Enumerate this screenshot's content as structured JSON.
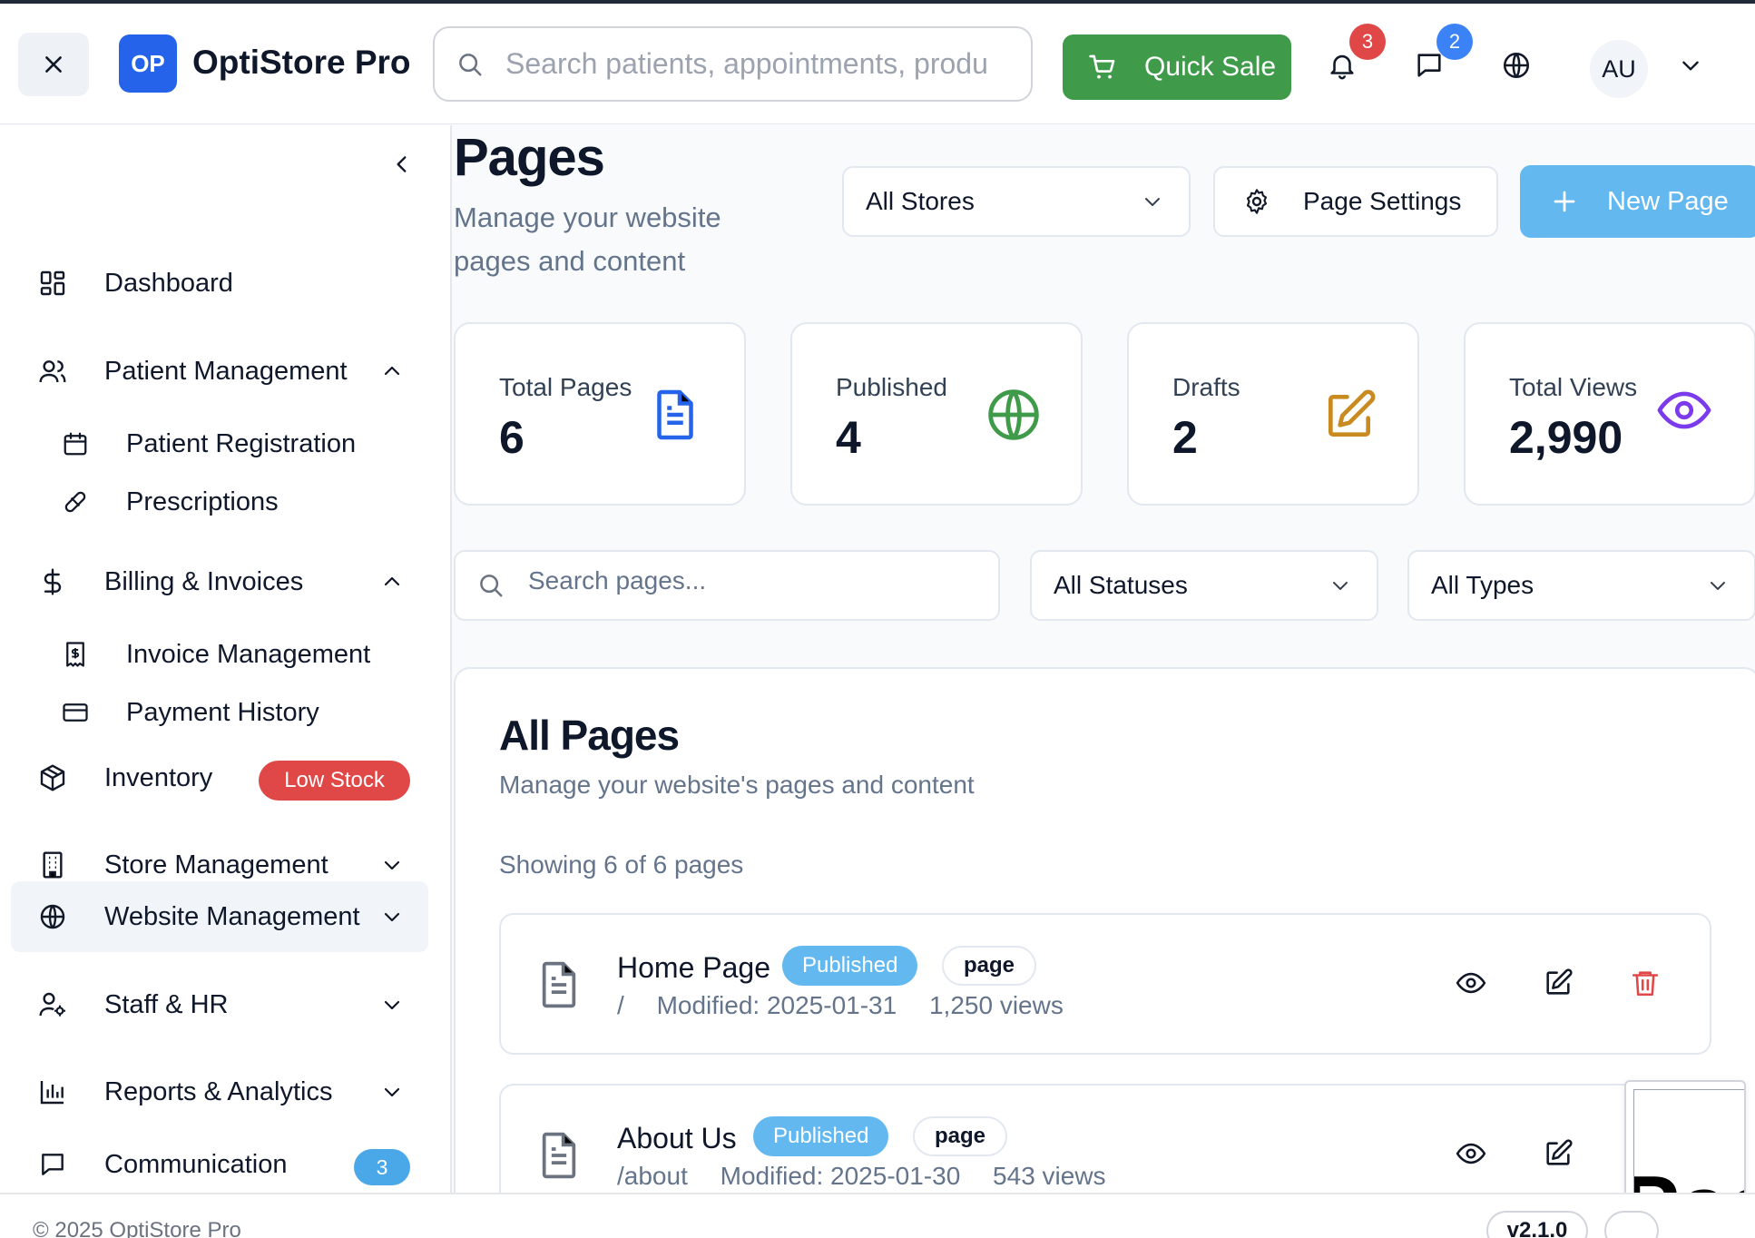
{
  "header": {
    "logo_initials": "OP",
    "brand": "OptiStore Pro",
    "search_placeholder": "Search patients, appointments, produ",
    "quick_sale_label": "Quick Sale",
    "notifications_count": "3",
    "messages_count": "2",
    "avatar_initials": "AU"
  },
  "sidebar": {
    "items": [
      {
        "label": "Dashboard",
        "icon": "dashboard-icon"
      },
      {
        "label": "Patient Management",
        "icon": "users-icon",
        "expanded": true
      },
      {
        "label": "Patient Registration",
        "icon": "calendar-icon"
      },
      {
        "label": "Prescriptions",
        "icon": "pill-icon"
      },
      {
        "label": "Billing & Invoices",
        "icon": "dollar-icon",
        "expanded": true
      },
      {
        "label": "Invoice Management",
        "icon": "receipt-icon"
      },
      {
        "label": "Payment History",
        "icon": "credit-card-icon"
      },
      {
        "label": "Inventory",
        "icon": "package-icon",
        "badge": "Low Stock"
      },
      {
        "label": "Store Management",
        "icon": "building-icon"
      },
      {
        "label": "Website Management",
        "icon": "globe-icon",
        "active": true
      },
      {
        "label": "Staff & HR",
        "icon": "user-cog-icon"
      },
      {
        "label": "Reports & Analytics",
        "icon": "bar-chart-icon"
      },
      {
        "label": "Communication",
        "icon": "message-icon",
        "badge": "3"
      }
    ]
  },
  "page": {
    "title": "Pages",
    "subtitle": "Manage your website pages and content",
    "store_select": "All Stores",
    "settings_label": "Page Settings",
    "new_page_label": "New Page"
  },
  "stats": [
    {
      "label": "Total Pages",
      "value": "6",
      "icon": "file-text-icon",
      "color": "#2563eb"
    },
    {
      "label": "Published",
      "value": "4",
      "icon": "globe-icon",
      "color": "#3f9b4a"
    },
    {
      "label": "Drafts",
      "value": "2",
      "icon": "edit-icon",
      "color": "#c98a1f"
    },
    {
      "label": "Total Views",
      "value": "2,990",
      "icon": "eye-icon",
      "color": "#7c3aed"
    }
  ],
  "filters": {
    "search_placeholder": "Search pages...",
    "status_select": "All Statuses",
    "type_select": "All Types"
  },
  "list": {
    "title": "All Pages",
    "subtitle": "Manage your website's pages and content",
    "showing": "Showing 6 of 6 pages",
    "rows": [
      {
        "name": "Home Page",
        "status": "Published",
        "type": "page",
        "path": "/",
        "modified": "Modified: 2025-01-31",
        "views": "1,250 views"
      },
      {
        "name": "About Us",
        "status": "Published",
        "type": "page",
        "path": "/about",
        "modified": "Modified: 2025-01-30",
        "views": "543 views"
      }
    ]
  },
  "footer": {
    "copyright": "© 2025 OptiStore Pro",
    "version": "v2.1.0"
  },
  "floating_preview_text": "Page",
  "colors": {
    "brand_blue": "#2563eb",
    "quick_sale_green": "#3f9b4a",
    "new_page_blue": "#63b8ef",
    "danger_red": "#e04848"
  }
}
